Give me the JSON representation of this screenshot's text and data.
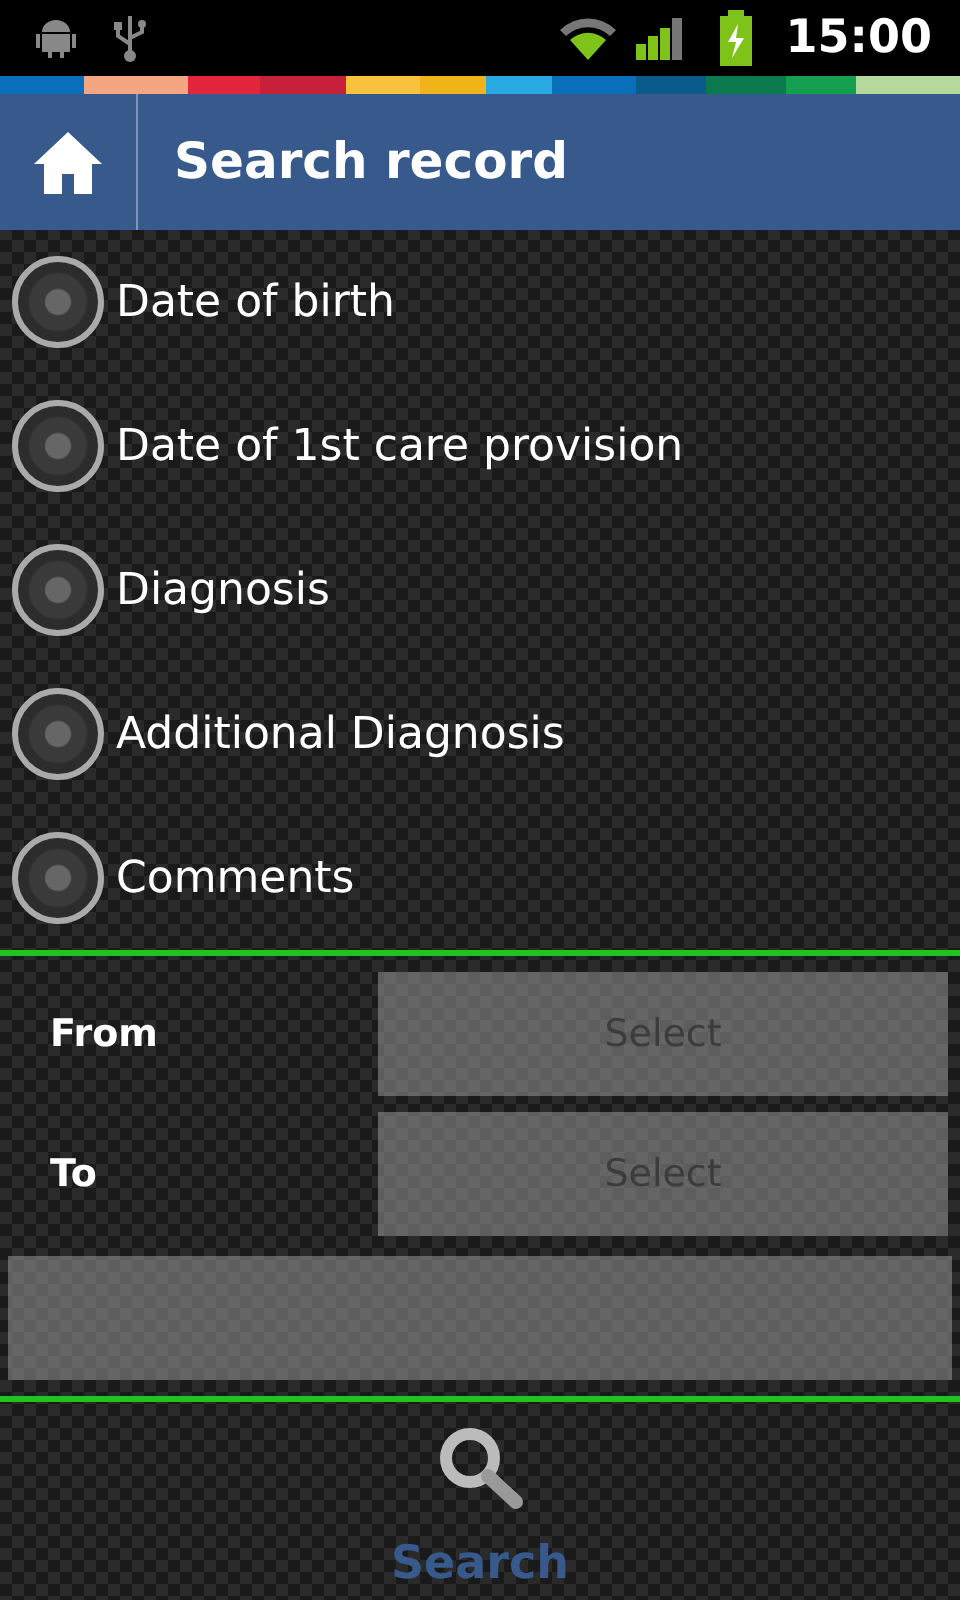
{
  "status_bar": {
    "time": "15:00"
  },
  "header": {
    "title": "Search record"
  },
  "options": [
    {
      "label": "Date of birth",
      "selected": false
    },
    {
      "label": "Date of 1st care provision",
      "selected": false
    },
    {
      "label": "Diagnosis",
      "selected": false
    },
    {
      "label": "Additional Diagnosis",
      "selected": false
    },
    {
      "label": "Comments",
      "selected": false
    }
  ],
  "range": [
    {
      "label": "From",
      "placeholder": "Select"
    },
    {
      "label": "To",
      "placeholder": "Select"
    }
  ],
  "search_button": {
    "label": "Search"
  }
}
